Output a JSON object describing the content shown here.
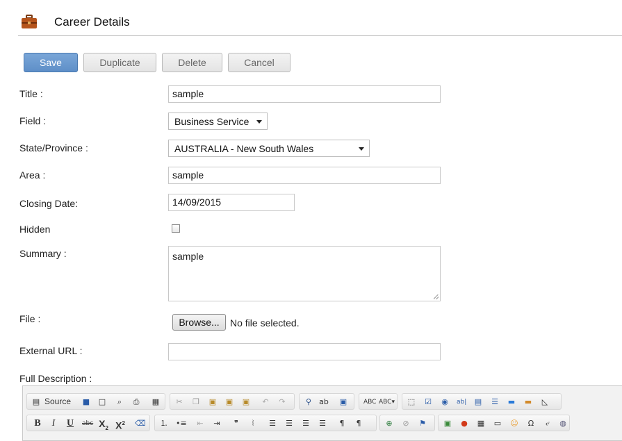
{
  "header": {
    "title": "Career Details",
    "icon": "briefcase-icon"
  },
  "actions": {
    "save": "Save",
    "duplicate": "Duplicate",
    "delete": "Delete",
    "cancel": "Cancel"
  },
  "form": {
    "title_label": "Title :",
    "title_value": "sample",
    "field_label": "Field :",
    "field_value": "Business Service",
    "state_label": "State/Province :",
    "state_value": "AUSTRALIA - New South Wales",
    "area_label": "Area :",
    "area_value": "sample",
    "closing_label": "Closing Date:",
    "closing_value": "14/09/2015",
    "hidden_label": "Hidden",
    "hidden_checked": false,
    "summary_label": "Summary :",
    "summary_value": "sample",
    "file_label": "File :",
    "browse_label": "Browse...",
    "no_file_text": "No file selected.",
    "external_label": "External URL :",
    "external_value": "",
    "full_desc_label": "Full Description :"
  },
  "editor_toolbar": {
    "source_label": "Source",
    "subscript_label": "X",
    "superscript_label": "X"
  },
  "colors": {
    "primary_button": "#5e8fc8",
    "rule": "#bdbdbd"
  }
}
